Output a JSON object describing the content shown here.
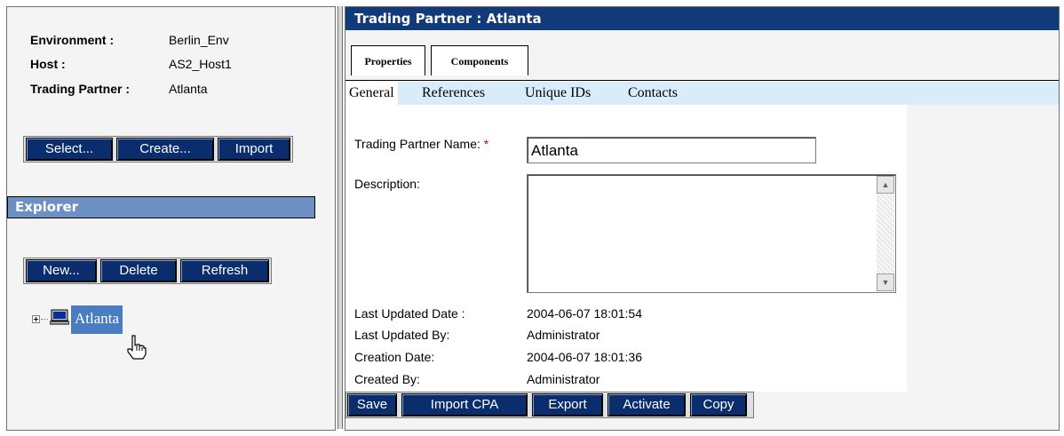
{
  "context": {
    "environment_label": "Environment :",
    "environment_value": "Berlin_Env",
    "host_label": "Host :",
    "host_value": "AS2_Host1",
    "partner_label": "Trading Partner :",
    "partner_value": "Atlanta"
  },
  "context_buttons": {
    "select": "Select...",
    "create": "Create...",
    "import": "Import"
  },
  "explorer": {
    "title": "Explorer",
    "buttons": {
      "new": "New...",
      "delete": "Delete",
      "refresh": "Refresh"
    },
    "tree": [
      {
        "label": "Atlanta",
        "icon": "computer-icon",
        "selected": true
      }
    ]
  },
  "detail": {
    "title": "Trading Partner : Atlanta",
    "tabs": [
      "Properties",
      "Components"
    ],
    "active_tab": "Properties",
    "subtabs": [
      "General",
      "References",
      "Unique IDs",
      "Contacts"
    ],
    "active_subtab": "General",
    "form": {
      "name_label": "Trading Partner Name:",
      "required_mark": "*",
      "name_value": "Atlanta",
      "description_label": "Description:",
      "description_value": "",
      "last_updated_date_label": "Last Updated Date :",
      "last_updated_date_value": "2004-06-07 18:01:54",
      "last_updated_by_label": "Last Updated By:",
      "last_updated_by_value": "Administrator",
      "creation_date_label": "Creation Date:",
      "creation_date_value": "2004-06-07 18:01:36",
      "created_by_label": "Created By:",
      "created_by_value": "Administrator"
    },
    "actions": {
      "save": "Save",
      "import_cpa": "Import CPA",
      "export": "Export",
      "activate": "Activate",
      "copy": "Copy"
    }
  },
  "colors": {
    "button_bg": "#0a2d6e",
    "title_bar": "#103a7a",
    "section_bar": "#6c8fc4",
    "subtab_bar": "#d9ecfa",
    "selection": "#4a7cc2"
  }
}
